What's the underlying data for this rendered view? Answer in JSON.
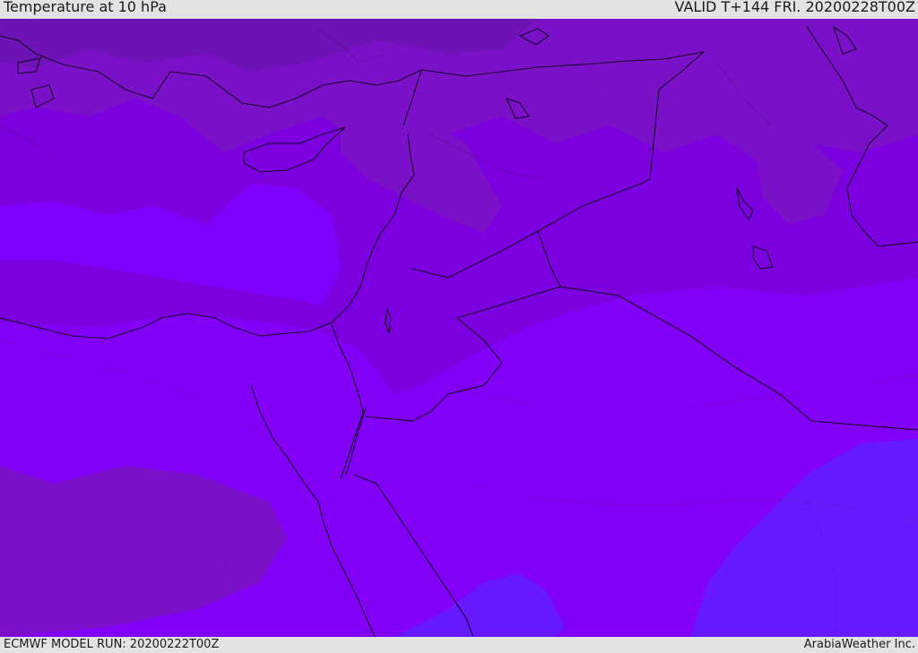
{
  "header": {
    "title": "Temperature at 10 hPa",
    "valid": "VALID T+144 FRI. 20200228T00Z"
  },
  "footer": {
    "model_run": "ECMWF MODEL RUN: 20200222T00Z",
    "credit": "ArabiaWeather Inc."
  },
  "map": {
    "region": "Eastern Mediterranean / Middle East",
    "variable": "temperature",
    "level_hpa": 10,
    "colors": {
      "dark": "#6d12b4",
      "darkmid": "#7a10c8",
      "mid": "#7c00df",
      "light": "#8200f7",
      "violet": "#7e00ff",
      "blue": "#6619ff",
      "border": "#1a0a2a"
    }
  }
}
